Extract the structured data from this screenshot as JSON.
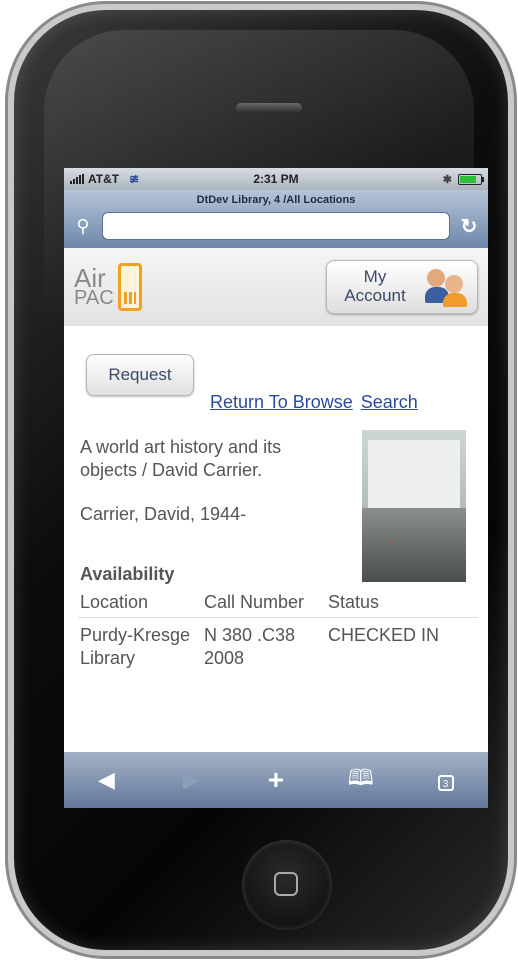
{
  "statusbar": {
    "carrier": "AT&T",
    "time": "2:31 PM"
  },
  "browser": {
    "page_title": "DtDev Library, 4 /All Locations",
    "url_value": ""
  },
  "header": {
    "logo_line1": "Air",
    "logo_line2": "PAC",
    "my_account_line1": "My",
    "my_account_line2": "Account"
  },
  "actions": {
    "request_label": "Request",
    "return_label": "Return To Browse",
    "search_label": "Search"
  },
  "record": {
    "title": "A world art history and its objects / David Carrier.",
    "author": "Carrier, David, 1944-"
  },
  "availability": {
    "heading": "Availability",
    "columns": [
      "Location",
      "Call Number",
      "Status"
    ],
    "rows": [
      {
        "location": "Purdy-Kresge Library",
        "call_number": "N 380 .C38 2008",
        "status": "CHECKED IN"
      }
    ]
  },
  "toolbar": {
    "icons": [
      "back-icon",
      "forward-icon",
      "add-icon",
      "bookmarks-icon",
      "pages-icon"
    ],
    "pages_count": "3"
  }
}
